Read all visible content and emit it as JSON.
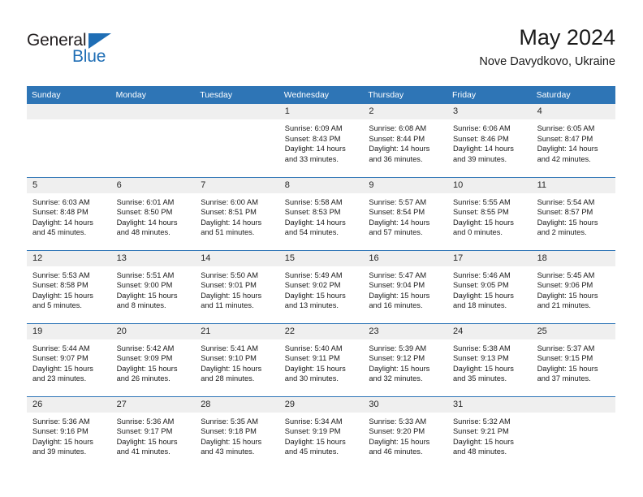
{
  "brand": {
    "name_top": "General",
    "name_bottom": "Blue",
    "triangle_color": "#1f6eb5"
  },
  "header": {
    "title": "May 2024",
    "location": "Nove Davydkovo, Ukraine"
  },
  "theme": {
    "header_blue": "#2e75b6",
    "daynum_bg": "#efefef",
    "text": "#1a1a1a"
  },
  "weekdays": [
    "Sunday",
    "Monday",
    "Tuesday",
    "Wednesday",
    "Thursday",
    "Friday",
    "Saturday"
  ],
  "labels": {
    "sunrise": "Sunrise:",
    "sunset": "Sunset:",
    "daylight": "Daylight:"
  },
  "weeks": [
    [
      {
        "day": "",
        "sunrise": "",
        "sunset": "",
        "daylight": ""
      },
      {
        "day": "",
        "sunrise": "",
        "sunset": "",
        "daylight": ""
      },
      {
        "day": "",
        "sunrise": "",
        "sunset": "",
        "daylight": ""
      },
      {
        "day": "1",
        "sunrise": "Sunrise: 6:09 AM",
        "sunset": "Sunset: 8:43 PM",
        "daylight": "Daylight: 14 hours and 33 minutes."
      },
      {
        "day": "2",
        "sunrise": "Sunrise: 6:08 AM",
        "sunset": "Sunset: 8:44 PM",
        "daylight": "Daylight: 14 hours and 36 minutes."
      },
      {
        "day": "3",
        "sunrise": "Sunrise: 6:06 AM",
        "sunset": "Sunset: 8:46 PM",
        "daylight": "Daylight: 14 hours and 39 minutes."
      },
      {
        "day": "4",
        "sunrise": "Sunrise: 6:05 AM",
        "sunset": "Sunset: 8:47 PM",
        "daylight": "Daylight: 14 hours and 42 minutes."
      }
    ],
    [
      {
        "day": "5",
        "sunrise": "Sunrise: 6:03 AM",
        "sunset": "Sunset: 8:48 PM",
        "daylight": "Daylight: 14 hours and 45 minutes."
      },
      {
        "day": "6",
        "sunrise": "Sunrise: 6:01 AM",
        "sunset": "Sunset: 8:50 PM",
        "daylight": "Daylight: 14 hours and 48 minutes."
      },
      {
        "day": "7",
        "sunrise": "Sunrise: 6:00 AM",
        "sunset": "Sunset: 8:51 PM",
        "daylight": "Daylight: 14 hours and 51 minutes."
      },
      {
        "day": "8",
        "sunrise": "Sunrise: 5:58 AM",
        "sunset": "Sunset: 8:53 PM",
        "daylight": "Daylight: 14 hours and 54 minutes."
      },
      {
        "day": "9",
        "sunrise": "Sunrise: 5:57 AM",
        "sunset": "Sunset: 8:54 PM",
        "daylight": "Daylight: 14 hours and 57 minutes."
      },
      {
        "day": "10",
        "sunrise": "Sunrise: 5:55 AM",
        "sunset": "Sunset: 8:55 PM",
        "daylight": "Daylight: 15 hours and 0 minutes."
      },
      {
        "day": "11",
        "sunrise": "Sunrise: 5:54 AM",
        "sunset": "Sunset: 8:57 PM",
        "daylight": "Daylight: 15 hours and 2 minutes."
      }
    ],
    [
      {
        "day": "12",
        "sunrise": "Sunrise: 5:53 AM",
        "sunset": "Sunset: 8:58 PM",
        "daylight": "Daylight: 15 hours and 5 minutes."
      },
      {
        "day": "13",
        "sunrise": "Sunrise: 5:51 AM",
        "sunset": "Sunset: 9:00 PM",
        "daylight": "Daylight: 15 hours and 8 minutes."
      },
      {
        "day": "14",
        "sunrise": "Sunrise: 5:50 AM",
        "sunset": "Sunset: 9:01 PM",
        "daylight": "Daylight: 15 hours and 11 minutes."
      },
      {
        "day": "15",
        "sunrise": "Sunrise: 5:49 AM",
        "sunset": "Sunset: 9:02 PM",
        "daylight": "Daylight: 15 hours and 13 minutes."
      },
      {
        "day": "16",
        "sunrise": "Sunrise: 5:47 AM",
        "sunset": "Sunset: 9:04 PM",
        "daylight": "Daylight: 15 hours and 16 minutes."
      },
      {
        "day": "17",
        "sunrise": "Sunrise: 5:46 AM",
        "sunset": "Sunset: 9:05 PM",
        "daylight": "Daylight: 15 hours and 18 minutes."
      },
      {
        "day": "18",
        "sunrise": "Sunrise: 5:45 AM",
        "sunset": "Sunset: 9:06 PM",
        "daylight": "Daylight: 15 hours and 21 minutes."
      }
    ],
    [
      {
        "day": "19",
        "sunrise": "Sunrise: 5:44 AM",
        "sunset": "Sunset: 9:07 PM",
        "daylight": "Daylight: 15 hours and 23 minutes."
      },
      {
        "day": "20",
        "sunrise": "Sunrise: 5:42 AM",
        "sunset": "Sunset: 9:09 PM",
        "daylight": "Daylight: 15 hours and 26 minutes."
      },
      {
        "day": "21",
        "sunrise": "Sunrise: 5:41 AM",
        "sunset": "Sunset: 9:10 PM",
        "daylight": "Daylight: 15 hours and 28 minutes."
      },
      {
        "day": "22",
        "sunrise": "Sunrise: 5:40 AM",
        "sunset": "Sunset: 9:11 PM",
        "daylight": "Daylight: 15 hours and 30 minutes."
      },
      {
        "day": "23",
        "sunrise": "Sunrise: 5:39 AM",
        "sunset": "Sunset: 9:12 PM",
        "daylight": "Daylight: 15 hours and 32 minutes."
      },
      {
        "day": "24",
        "sunrise": "Sunrise: 5:38 AM",
        "sunset": "Sunset: 9:13 PM",
        "daylight": "Daylight: 15 hours and 35 minutes."
      },
      {
        "day": "25",
        "sunrise": "Sunrise: 5:37 AM",
        "sunset": "Sunset: 9:15 PM",
        "daylight": "Daylight: 15 hours and 37 minutes."
      }
    ],
    [
      {
        "day": "26",
        "sunrise": "Sunrise: 5:36 AM",
        "sunset": "Sunset: 9:16 PM",
        "daylight": "Daylight: 15 hours and 39 minutes."
      },
      {
        "day": "27",
        "sunrise": "Sunrise: 5:36 AM",
        "sunset": "Sunset: 9:17 PM",
        "daylight": "Daylight: 15 hours and 41 minutes."
      },
      {
        "day": "28",
        "sunrise": "Sunrise: 5:35 AM",
        "sunset": "Sunset: 9:18 PM",
        "daylight": "Daylight: 15 hours and 43 minutes."
      },
      {
        "day": "29",
        "sunrise": "Sunrise: 5:34 AM",
        "sunset": "Sunset: 9:19 PM",
        "daylight": "Daylight: 15 hours and 45 minutes."
      },
      {
        "day": "30",
        "sunrise": "Sunrise: 5:33 AM",
        "sunset": "Sunset: 9:20 PM",
        "daylight": "Daylight: 15 hours and 46 minutes."
      },
      {
        "day": "31",
        "sunrise": "Sunrise: 5:32 AM",
        "sunset": "Sunset: 9:21 PM",
        "daylight": "Daylight: 15 hours and 48 minutes."
      },
      {
        "day": "",
        "sunrise": "",
        "sunset": "",
        "daylight": ""
      }
    ]
  ]
}
